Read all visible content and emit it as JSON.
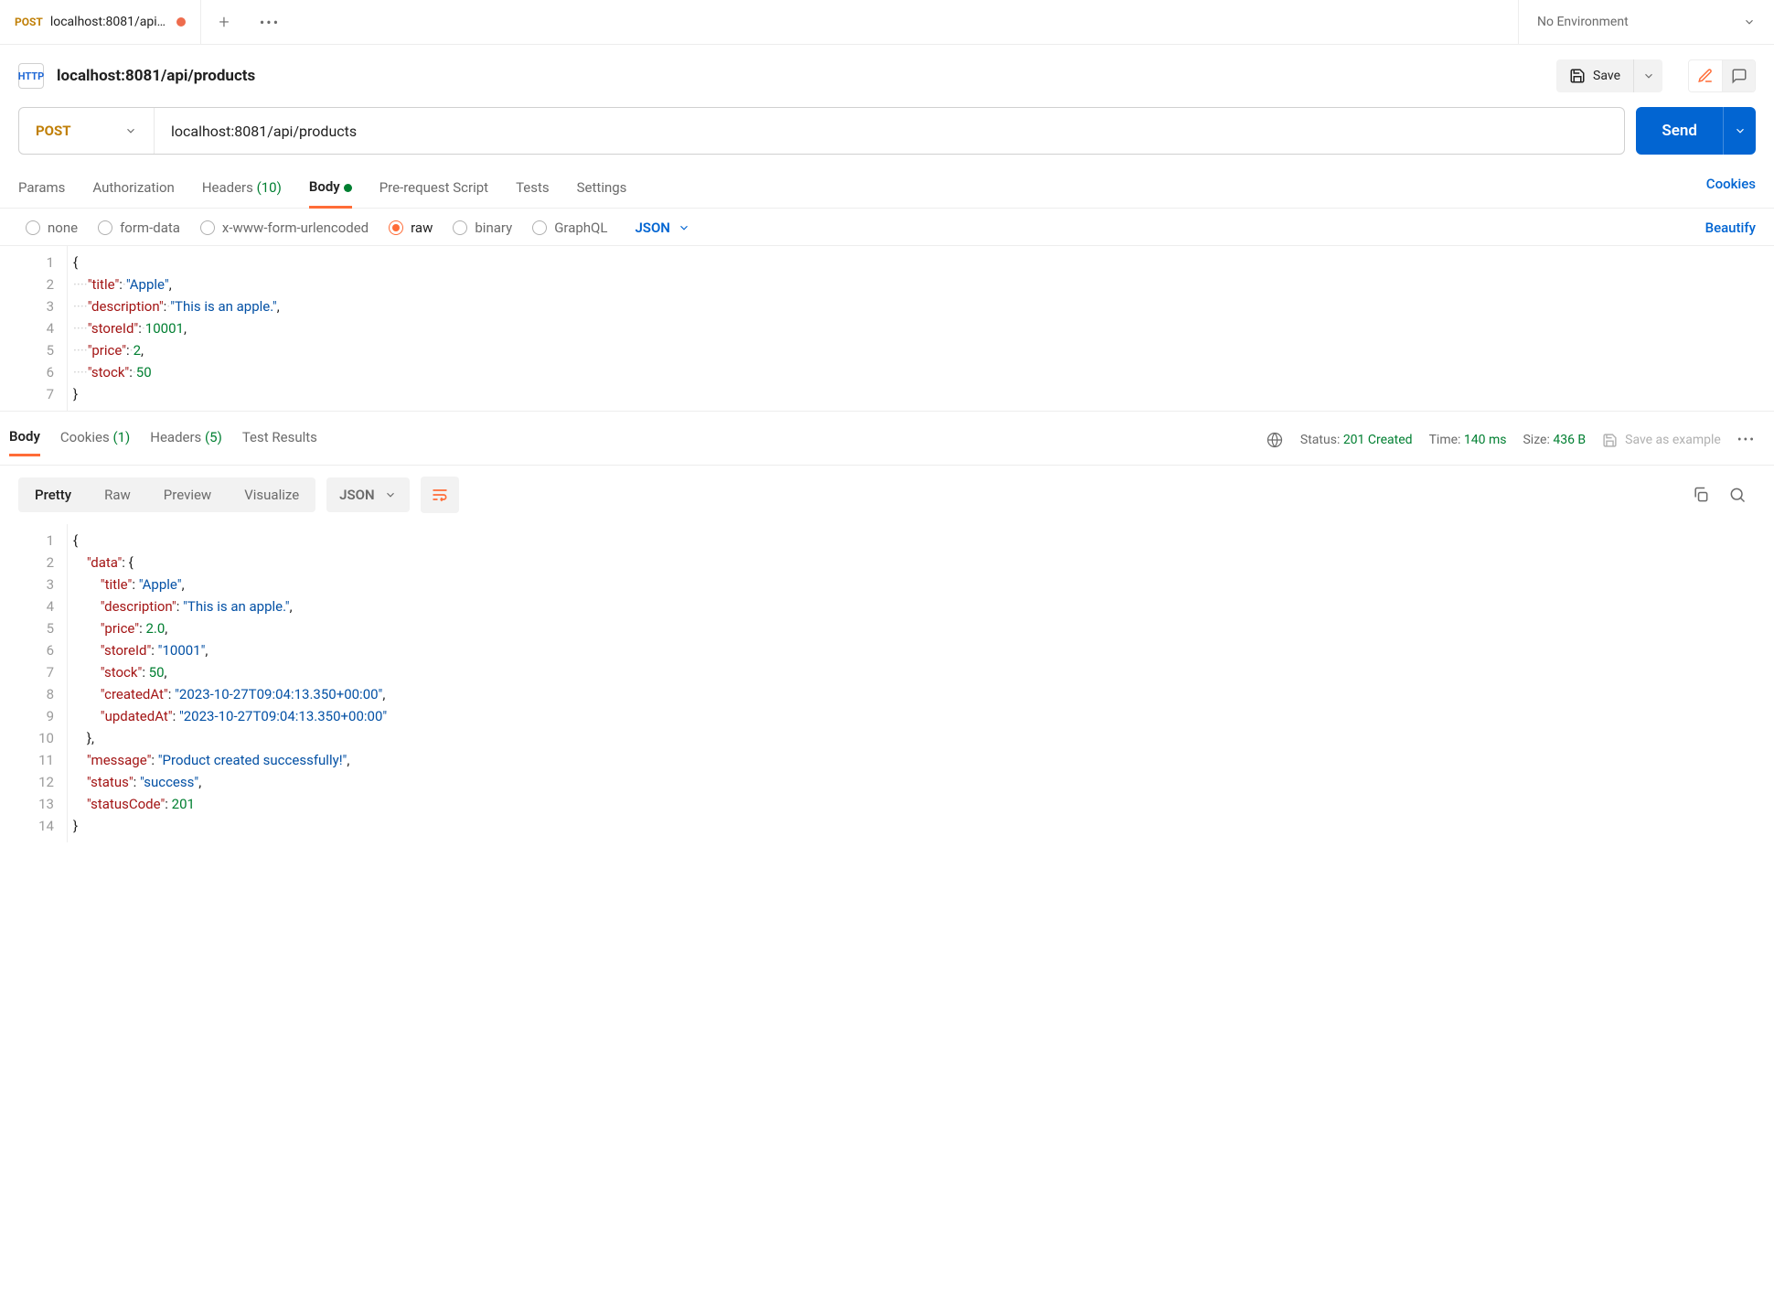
{
  "tab": {
    "method": "POST",
    "title": "localhost:8081/api/pro",
    "env": "No Environment"
  },
  "header": {
    "icon_label": "HTTP",
    "title": "localhost:8081/api/products",
    "save": "Save"
  },
  "request": {
    "method": "POST",
    "url": "localhost:8081/api/products",
    "send": "Send"
  },
  "req_tabs": {
    "params": "Params",
    "auth": "Authorization",
    "headers_label": "Headers ",
    "headers_count": "(10)",
    "body": "Body",
    "prereq": "Pre-request Script",
    "tests": "Tests",
    "settings": "Settings",
    "cookies": "Cookies"
  },
  "body_types": {
    "none": "none",
    "form": "form-data",
    "xform": "x-www-form-urlencoded",
    "raw": "raw",
    "binary": "binary",
    "graphql": "GraphQL",
    "format": "JSON",
    "beautify": "Beautify"
  },
  "request_body": {
    "title": "Apple",
    "description": "This is an apple.",
    "storeId": 10001,
    "price": 2,
    "stock": 50
  },
  "response_status": {
    "status_label": "Status: ",
    "status_value": "201 Created",
    "time_label": "Time: ",
    "time_value": "140 ms",
    "size_label": "Size: ",
    "size_value": "436 B",
    "save_example": "Save as example"
  },
  "resp_tabs": {
    "body": "Body",
    "cookies_label": "Cookies ",
    "cookies_count": "(1)",
    "headers_label": "Headers ",
    "headers_count": "(5)",
    "tests": "Test Results"
  },
  "resp_view": {
    "pretty": "Pretty",
    "raw": "Raw",
    "preview": "Preview",
    "visualize": "Visualize",
    "format": "JSON"
  },
  "response_body": {
    "data": {
      "title": "Apple",
      "description": "This is an apple.",
      "price": 2.0,
      "storeId": "10001",
      "stock": 50,
      "createdAt": "2023-10-27T09:04:13.350+00:00",
      "updatedAt": "2023-10-27T09:04:13.350+00:00"
    },
    "message": "Product created successfully!",
    "status": "success",
    "statusCode": 201
  }
}
